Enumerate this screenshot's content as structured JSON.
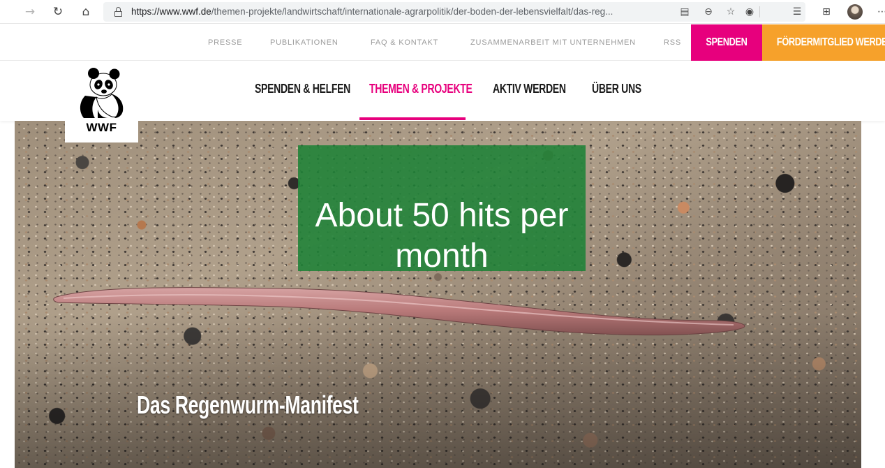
{
  "browser": {
    "url_host": "https://www.wwf.de",
    "url_path": "/themen-projekte/landwirtschaft/internationale-agrarpolitik/der-boden-der-lebensvielfalt/das-reg..."
  },
  "topbar": {
    "links": [
      "PRESSE",
      "PUBLIKATIONEN",
      "FAQ & KONTAKT",
      "ZUSAMMENARBEIT MIT UNTERNEHMEN",
      "RSS"
    ],
    "donate_label": "SPENDEN",
    "member_label": "FÖRDERMITGLIED WERDEN"
  },
  "logo": {
    "text": "WWF"
  },
  "mainnav": {
    "items": [
      {
        "label": "SPENDEN & HELFEN",
        "active": false
      },
      {
        "label": "THEMEN & PROJEKTE",
        "active": true
      },
      {
        "label": "AKTIV WERDEN",
        "active": false
      },
      {
        "label": "ÜBER UNS",
        "active": false
      }
    ]
  },
  "hero": {
    "title": "Das Regenwurm-Manifest"
  },
  "callout": {
    "line1": "About 50 hits per",
    "line2": "month"
  },
  "colors": {
    "pink": "#e7007d",
    "orange": "#f6a12b",
    "green": "#1e8237"
  }
}
